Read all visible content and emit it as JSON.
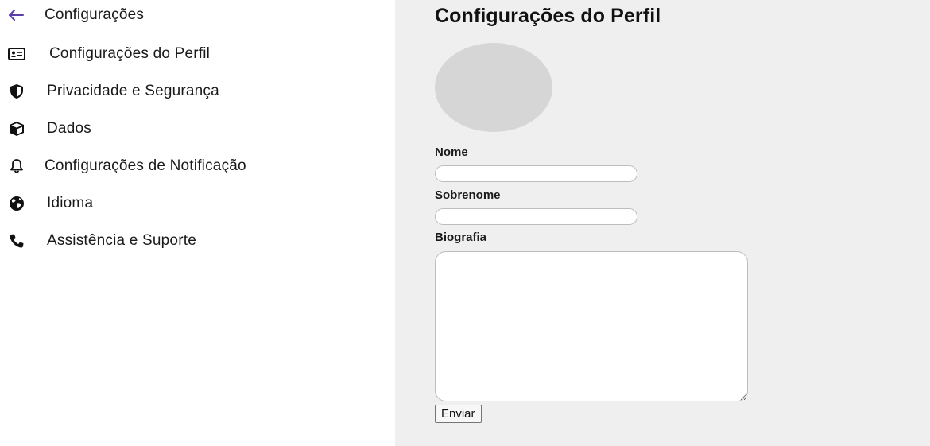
{
  "sidebar": {
    "title": "Configurações",
    "back_icon": "arrow-left-icon",
    "accent_color": "#5b3fa8",
    "items": [
      {
        "label": "Configurações do Perfil",
        "icon": "id-card-icon"
      },
      {
        "label": "Privacidade e Segurança",
        "icon": "shield-icon"
      },
      {
        "label": "Dados",
        "icon": "cube-icon"
      },
      {
        "label": "Configurações de Notificação",
        "icon": "bell-icon"
      },
      {
        "label": "Idioma",
        "icon": "globe-icon"
      },
      {
        "label": "Assistência e Suporte",
        "icon": "phone-icon"
      }
    ]
  },
  "main": {
    "title": "Configurações do Perfil",
    "background": "#efefef",
    "avatar_color": "#d6d6d6",
    "form": {
      "first_name_label": "Nome",
      "first_name_value": "",
      "last_name_label": "Sobrenome",
      "last_name_value": "",
      "bio_label": "Biografia",
      "bio_value": "",
      "submit_label": "Enviar"
    }
  }
}
